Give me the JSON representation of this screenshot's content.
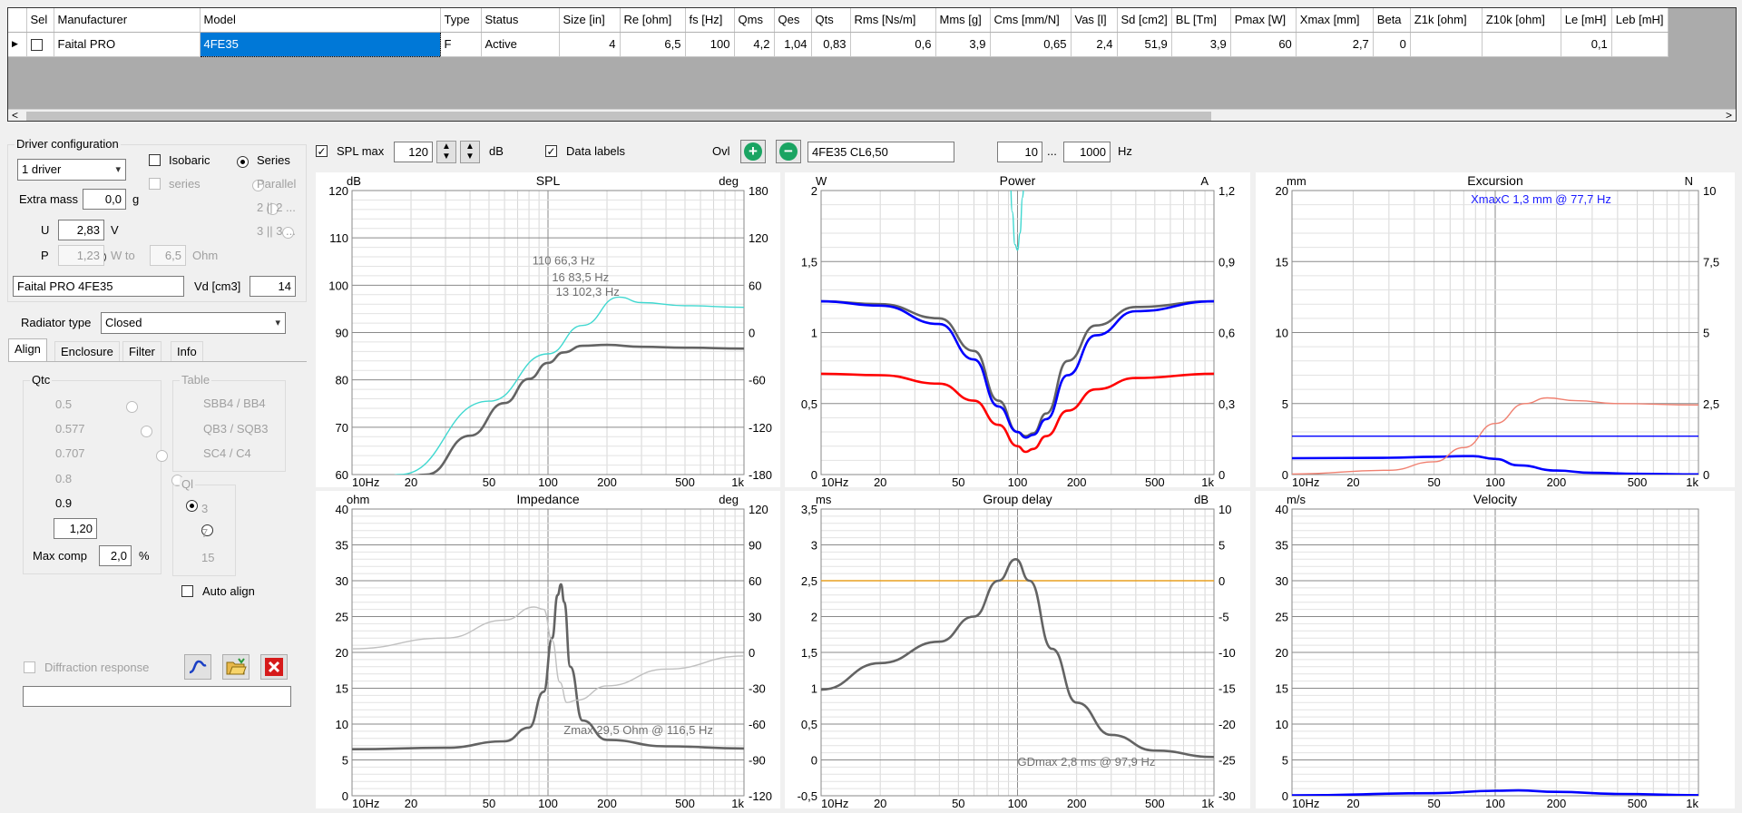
{
  "table": {
    "headers": [
      "",
      "Sel",
      "Manufacturer",
      "Model",
      "Type",
      "Status",
      "Size [in]",
      "Re [ohm]",
      "fs [Hz]",
      "Qms",
      "Qes",
      "Qts",
      "Rms [Ns/m]",
      "Mms [g]",
      "Cms [mm/N]",
      "Vas [l]",
      "Sd [cm2]",
      "BL [Tm]",
      "Pmax [W]",
      "Xmax [mm]",
      "Beta",
      "Z1k [ohm]",
      "Z10k [ohm]",
      "Le [mH]",
      "Leb [mH]"
    ],
    "row": {
      "arrow": "▶",
      "manufacturer": "Faital PRO",
      "model": "4FE35",
      "type": "F",
      "status": "Active",
      "size": "4",
      "re": "6,5",
      "fs": "100",
      "qms": "4,2",
      "qes": "1,04",
      "qts": "0,83",
      "rms": "0,6",
      "mms": "3,9",
      "cms": "0,65",
      "vas": "2,4",
      "sd": "51,9",
      "bl": "3,9",
      "pmax": "60",
      "xmax": "2,7",
      "beta": "0",
      "z1k": "",
      "z10k": "",
      "le": "0,1",
      "leb": ""
    },
    "scroll_left": "<",
    "scroll_right": ">"
  },
  "driver_config": {
    "title": "Driver configuration",
    "drivers_selected": "1 driver",
    "isobaric_label": "Isobaric",
    "series_label": "Series",
    "iso_series_label": "series",
    "parallel_label": "Parallel",
    "two_label": "2 || 2 ...",
    "three_label": "3 || 3 ...",
    "extra_mass_label": "Extra mass",
    "extra_mass_value": "0,0",
    "extra_mass_unit": "g",
    "u_label": "U",
    "u_value": "2,83",
    "u_unit": "V",
    "p_label": "P",
    "p_value": "1,23",
    "w_to_label": "W to",
    "ohm_value": "6,5",
    "ohm_label": "Ohm",
    "driver_name": "Faital PRO 4FE35",
    "vd_label": "Vd [cm3]",
    "vd_value": "14"
  },
  "radiator": {
    "label": "Radiator type",
    "value": "Closed"
  },
  "tabs": [
    "Align",
    "Enclosure",
    "Filter",
    "Info"
  ],
  "align": {
    "qtc_title": "Qtc",
    "qtc_options": [
      "0.5",
      "0.577",
      "0.707",
      "0.8",
      "0.9"
    ],
    "qtc_custom": "1,20",
    "max_comp_label": "Max comp",
    "max_comp_value": "2,0",
    "max_comp_unit": "%",
    "table_title": "Table",
    "table_options": [
      "SBB4 / BB4",
      "QB3 / SQB3",
      "SC4 / C4"
    ],
    "ql_title": "Ql",
    "ql_options": [
      "3",
      "7",
      "15"
    ],
    "auto_align_label": "Auto align",
    "diffraction_label": "Diffraction response",
    "diffraction_value": ""
  },
  "toolbar": {
    "spl_max_label": "SPL max",
    "spl_max_value": "120",
    "spl_unit": "dB",
    "data_labels_label": "Data labels",
    "ovl_label": "Ovl",
    "add_symbol": "+",
    "remove_symbol": "−",
    "overlay_name": "4FE35 CL6,50",
    "freq_from": "10",
    "freq_sep": "...",
    "freq_to": "1000",
    "freq_unit": "Hz"
  },
  "icons": {
    "curve": "curve-icon",
    "open": "folder-open-icon",
    "delete": "delete-icon"
  },
  "colors": {
    "accent": "#0078d7",
    "gray_curve": "#636363",
    "cyan_curve": "#40d8d0",
    "blue_curve": "#0000ff",
    "red_curve": "#ff0000",
    "salmon_curve": "#f08070",
    "light_gray_curve": "#c0c0c0",
    "orange_line": "#e8a020"
  },
  "chart_data": [
    {
      "type": "line",
      "title": "SPL",
      "left_unit": "dB",
      "right_unit": "deg",
      "xticks": [
        "10Hz",
        "20",
        "50",
        "100",
        "200",
        "500",
        "1k"
      ],
      "yticks_left": [
        "120",
        "110",
        "100",
        "90",
        "80",
        "70",
        "60"
      ],
      "yticks_right": [
        "180",
        "120",
        "60",
        "0",
        "-60",
        "-120",
        "-180"
      ],
      "ylim_left": [
        60,
        120
      ],
      "ylim_right": [
        -180,
        180
      ],
      "xlim": [
        10,
        1000
      ],
      "series": [
        {
          "color": "#636363",
          "axis": "left",
          "x": [
            10,
            24,
            40,
            60,
            80,
            100,
            120,
            150,
            200,
            300,
            500,
            1000
          ],
          "y": [
            54,
            60,
            68.2,
            75.1,
            80.2,
            83.6,
            85.8,
            87.2,
            87.4,
            87.0,
            86.8,
            86.6
          ]
        },
        {
          "color": "#40d8d0",
          "axis": "right",
          "x": [
            10,
            17.5,
            50,
            100,
            150,
            230,
            300,
            500,
            1000
          ],
          "y": [
            -216,
            -180,
            -87,
            -27,
            9,
            45,
            38,
            34,
            32
          ]
        }
      ],
      "annotations": [
        "13 102,3 Hz",
        "16 83,5 Hz",
        "110 66,3 Hz"
      ]
    },
    {
      "type": "line",
      "title": "Power",
      "left_unit": "W",
      "right_unit": "A",
      "xticks": [
        "10Hz",
        "20",
        "50",
        "100",
        "200",
        "500",
        "1k"
      ],
      "yticks_left": [
        "2",
        "1,5",
        "1",
        "0,5",
        "0"
      ],
      "yticks_right": [
        "1,2",
        "0,9",
        "0,6",
        "0,3",
        "0"
      ],
      "ylim_left": [
        0,
        2
      ],
      "ylim_right": [
        0,
        1.2
      ],
      "xlim": [
        10,
        1000
      ],
      "series": [
        {
          "color": "#636363",
          "axis": "left",
          "x": [
            10,
            20,
            40,
            60,
            80,
            100,
            110,
            120,
            140,
            180,
            250,
            400,
            1000
          ],
          "y": [
            1.22,
            1.2,
            1.1,
            0.87,
            0.52,
            0.3,
            0.27,
            0.29,
            0.43,
            0.8,
            1.05,
            1.18,
            1.22
          ]
        },
        {
          "color": "#0000ff",
          "axis": "left",
          "x": [
            10,
            20,
            40,
            60,
            80,
            100,
            110,
            120,
            140,
            180,
            250,
            400,
            1000
          ],
          "y": [
            1.22,
            1.19,
            1.06,
            0.81,
            0.48,
            0.3,
            0.26,
            0.28,
            0.39,
            0.7,
            0.98,
            1.15,
            1.22
          ]
        },
        {
          "color": "#ff0000",
          "axis": "left",
          "x": [
            10,
            20,
            40,
            60,
            80,
            100,
            110,
            120,
            140,
            180,
            250,
            400,
            1000
          ],
          "y": [
            0.71,
            0.7,
            0.64,
            0.52,
            0.35,
            0.2,
            0.16,
            0.18,
            0.27,
            0.45,
            0.6,
            0.68,
            0.71
          ]
        },
        {
          "color": "#40d8d0",
          "axis": "left",
          "x": [
            91,
            94,
            97,
            100,
            103,
            106,
            109
          ],
          "y": [
            2.2,
            1.85,
            1.62,
            1.58,
            1.7,
            1.95,
            2.2
          ]
        }
      ]
    },
    {
      "type": "line",
      "title": "Excursion",
      "left_unit": "mm",
      "right_unit": "N",
      "xticks": [
        "10Hz",
        "20",
        "50",
        "100",
        "200",
        "500",
        "1k"
      ],
      "yticks_left": [
        "20",
        "15",
        "10",
        "5",
        "0"
      ],
      "yticks_right": [
        "10",
        "7,5",
        "5",
        "2,5",
        "0"
      ],
      "ylim_left": [
        0,
        20
      ],
      "ylim_right": [
        0,
        10
      ],
      "xlim": [
        10,
        1000
      ],
      "series": [
        {
          "color": "#0000ff",
          "axis": "left",
          "x": [
            10,
            1000
          ],
          "y": [
            2.7,
            2.7
          ]
        },
        {
          "color": "#0000ff",
          "axis": "left",
          "x": [
            10,
            30,
            50,
            70,
            78,
            100,
            130,
            200,
            300,
            500,
            1000
          ],
          "y": [
            1.15,
            1.18,
            1.25,
            1.3,
            1.3,
            1.1,
            0.65,
            0.28,
            0.12,
            0.05,
            0.01
          ]
        },
        {
          "color": "#f08070",
          "axis": "right",
          "x": [
            10,
            30,
            50,
            70,
            100,
            140,
            180,
            250,
            400,
            1000
          ],
          "y": [
            0.02,
            0.15,
            0.45,
            0.95,
            1.8,
            2.5,
            2.7,
            2.6,
            2.5,
            2.45
          ]
        }
      ],
      "annotations": [
        "XmaxC 1,3 mm  @ 77,7 Hz"
      ]
    },
    {
      "type": "line",
      "title": "Impedance",
      "left_unit": "ohm",
      "right_unit": "deg",
      "xticks": [
        "10Hz",
        "20",
        "50",
        "100",
        "200",
        "500",
        "1k"
      ],
      "yticks_left": [
        "40",
        "35",
        "30",
        "25",
        "20",
        "15",
        "10",
        "5",
        "0"
      ],
      "yticks_right": [
        "120",
        "90",
        "60",
        "30",
        "0",
        "-30",
        "-60",
        "-90",
        "-120"
      ],
      "ylim_left": [
        0,
        40
      ],
      "ylim_right": [
        -120,
        120
      ],
      "xlim": [
        10,
        1000
      ],
      "series": [
        {
          "color": "#636363",
          "axis": "left",
          "x": [
            10,
            30,
            60,
            80,
            95,
            105,
            112,
            116.5,
            121,
            130,
            150,
            200,
            400,
            1000
          ],
          "y": [
            6.5,
            6.7,
            7.6,
            9.5,
            14.5,
            22,
            28,
            29.5,
            27,
            18,
            10.5,
            7.8,
            6.9,
            6.6
          ]
        },
        {
          "color": "#c0c0c0",
          "axis": "right",
          "x": [
            10,
            30,
            60,
            85,
            95,
            105,
            115,
            125,
            140,
            200,
            400,
            1000
          ],
          "y": [
            3,
            12,
            27,
            38,
            36,
            10,
            -25,
            -42,
            -40,
            -28,
            -14,
            -3
          ]
        }
      ],
      "annotations": [
        "Zmax 29,5 Ohm @ 116,5 Hz"
      ]
    },
    {
      "type": "line",
      "title": "Group delay",
      "left_unit": "ms",
      "right_unit": "dB",
      "xticks": [
        "10Hz",
        "20",
        "50",
        "100",
        "200",
        "500",
        "1k"
      ],
      "yticks_left": [
        "3,5",
        "3",
        "2,5",
        "2",
        "1,5",
        "1",
        "0,5",
        "0",
        "-0,5"
      ],
      "yticks_right": [
        "10",
        "5",
        "0",
        "-5",
        "-10",
        "-15",
        "-20",
        "-25",
        "-30"
      ],
      "ylim_left": [
        -0.5,
        3.5
      ],
      "ylim_right": [
        -30,
        10
      ],
      "xlim": [
        10,
        1000
      ],
      "series": [
        {
          "color": "#e8a020",
          "axis": "left",
          "x": [
            10,
            1000
          ],
          "y": [
            2.5,
            2.5
          ]
        },
        {
          "color": "#636363",
          "axis": "left",
          "x": [
            10,
            20,
            40,
            60,
            80,
            97.9,
            115,
            150,
            200,
            300,
            500,
            1000
          ],
          "y": [
            0.98,
            1.35,
            1.65,
            2.0,
            2.5,
            2.8,
            2.5,
            1.55,
            0.8,
            0.35,
            0.13,
            0.04
          ]
        }
      ],
      "annotations": [
        "GDmax 2,8 ms  @ 97,9 Hz"
      ]
    },
    {
      "type": "line",
      "title": "Velocity",
      "left_unit": "m/s",
      "right_unit": "",
      "xticks": [
        "10Hz",
        "20",
        "50",
        "100",
        "200",
        "500",
        "1k"
      ],
      "yticks_left": [
        "40",
        "35",
        "30",
        "25",
        "20",
        "15",
        "10",
        "5",
        "0"
      ],
      "yticks_right": [],
      "ylim_left": [
        0,
        40
      ],
      "xlim": [
        10,
        1000
      ],
      "series": [
        {
          "color": "#0000ff",
          "axis": "left",
          "x": [
            10,
            50,
            100,
            130,
            200,
            400,
            1000
          ],
          "y": [
            0.05,
            0.35,
            0.7,
            0.75,
            0.55,
            0.25,
            0.08
          ]
        }
      ]
    }
  ]
}
